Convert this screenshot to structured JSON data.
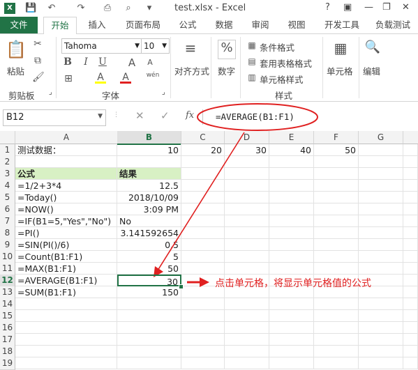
{
  "title": "test.xlsx - Excel",
  "window_controls": {
    "help": "?",
    "minimize": "—",
    "restore": "❐",
    "close": "✕"
  },
  "tabs": [
    "文件",
    "开始",
    "插入",
    "页面布局",
    "公式",
    "数据",
    "审阅",
    "视图",
    "开发工具",
    "负载测试"
  ],
  "ribbon": {
    "paste": "粘贴",
    "clipboard": "剪贴板",
    "font_name": "Tahoma",
    "font_size": "10",
    "font_group": "字体",
    "align": "对齐方式",
    "number": "数字",
    "number_symbol": "%",
    "cond_format": "条件格式",
    "table_format": "套用表格格式",
    "cell_style": "单元格样式",
    "styles_group": "样式",
    "cells": "单元格",
    "edit": "编辑",
    "bold": "B",
    "italic": "I",
    "underline": "U",
    "grow_font": "A",
    "shrink_font": "A",
    "fill_color_letter": "A",
    "font_color_letter": "A",
    "wen": "wén"
  },
  "formula_bar": {
    "name_box": "B12",
    "fx": "fx",
    "formula": "=AVERAGE(B1:F1)"
  },
  "columns": [
    "A",
    "B",
    "C",
    "D",
    "E",
    "F",
    "G"
  ],
  "rows": [
    {
      "n": "1",
      "a": "测试数据：",
      "b": "10",
      "c": "20",
      "d": "30",
      "e": "40",
      "f": "50"
    },
    {
      "n": "2",
      "a": "",
      "b": ""
    },
    {
      "n": "3",
      "a": "公式",
      "b": "结果"
    },
    {
      "n": "4",
      "a": "=1/2+3*4",
      "b": "12.5"
    },
    {
      "n": "5",
      "a": "=Today()",
      "b": "2018/10/09"
    },
    {
      "n": "6",
      "a": "=NOW()",
      "b": "3:09 PM"
    },
    {
      "n": "7",
      "a": "=IF(B1=5,\"Yes\",\"No\")",
      "b": "No"
    },
    {
      "n": "8",
      "a": "=PI()",
      "b": "3.141592654"
    },
    {
      "n": "9",
      "a": "=SIN(PI()/6)",
      "b": "0.5"
    },
    {
      "n": "10",
      "a": "=Count(B1:F1)",
      "b": "5"
    },
    {
      "n": "11",
      "a": "=MAX(B1:F1)",
      "b": "50"
    },
    {
      "n": "12",
      "a": "=AVERAGE(B1:F1)",
      "b": "30"
    },
    {
      "n": "13",
      "a": "=SUM(B1:F1)",
      "b": "150"
    },
    {
      "n": "14"
    },
    {
      "n": "15"
    },
    {
      "n": "16"
    },
    {
      "n": "17"
    },
    {
      "n": "18"
    },
    {
      "n": "19"
    }
  ],
  "annotation": "点击单元格，将显示单元格值的公式",
  "colors": {
    "accent": "#217346",
    "header_fill": "#d8f0c4",
    "annotation": "#e02020"
  }
}
